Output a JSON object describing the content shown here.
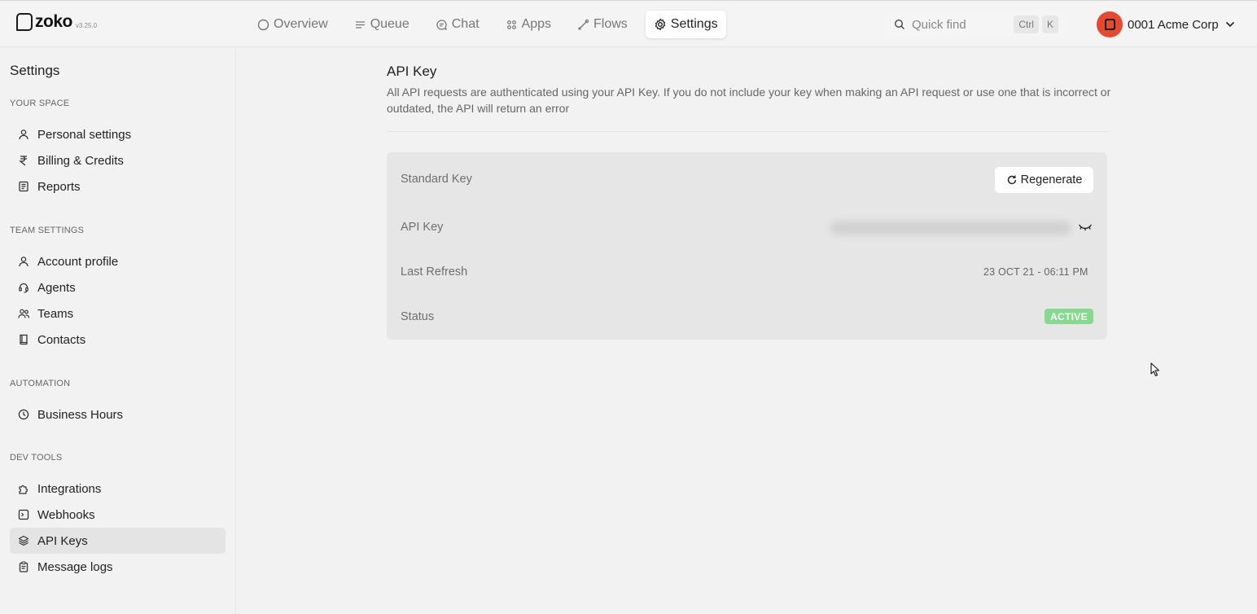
{
  "app": {
    "logo_text": "zoko",
    "version": "v3.25.0"
  },
  "nav": {
    "items": [
      {
        "label": "Overview",
        "icon": "circle-icon"
      },
      {
        "label": "Queue",
        "icon": "queue-icon"
      },
      {
        "label": "Chat",
        "icon": "chat-icon"
      },
      {
        "label": "Apps",
        "icon": "apps-icon"
      },
      {
        "label": "Flows",
        "icon": "flows-icon"
      },
      {
        "label": "Settings",
        "icon": "gear-icon",
        "active": true
      }
    ]
  },
  "search": {
    "placeholder": "Quick find",
    "shortcut_1": "Ctrl",
    "shortcut_2": "K"
  },
  "account": {
    "name": "0001 Acme Corp",
    "avatar_color": "#e8492e"
  },
  "sidebar": {
    "title": "Settings",
    "sections": [
      {
        "title": "YOUR SPACE",
        "items": [
          "Personal settings",
          "Billing & Credits",
          "Reports"
        ]
      },
      {
        "title": "TEAM SETTINGS",
        "items": [
          "Account profile",
          "Agents",
          "Teams",
          "Contacts"
        ]
      },
      {
        "title": "AUTOMATION",
        "items": [
          "Business Hours"
        ]
      },
      {
        "title": "DEV TOOLS",
        "items": [
          "Integrations",
          "Webhooks",
          "API Keys",
          "Message logs"
        ]
      }
    ],
    "active_item": "API Keys"
  },
  "main": {
    "title": "API Key",
    "description": "All API requests are authenticated using your API Key. If you do not include your key when making an API request or use one that is incorrect or outdated, the API will return an error"
  },
  "key_card": {
    "standard_key_label": "Standard Key",
    "regenerate_label": "Regenerate",
    "api_key_label": "API Key",
    "last_refresh_label": "Last Refresh",
    "last_refresh_value": "23 OCT 21 - 06:11 PM",
    "status_label": "Status",
    "status_value": "ACTIVE",
    "status_color": "#86d98f"
  }
}
